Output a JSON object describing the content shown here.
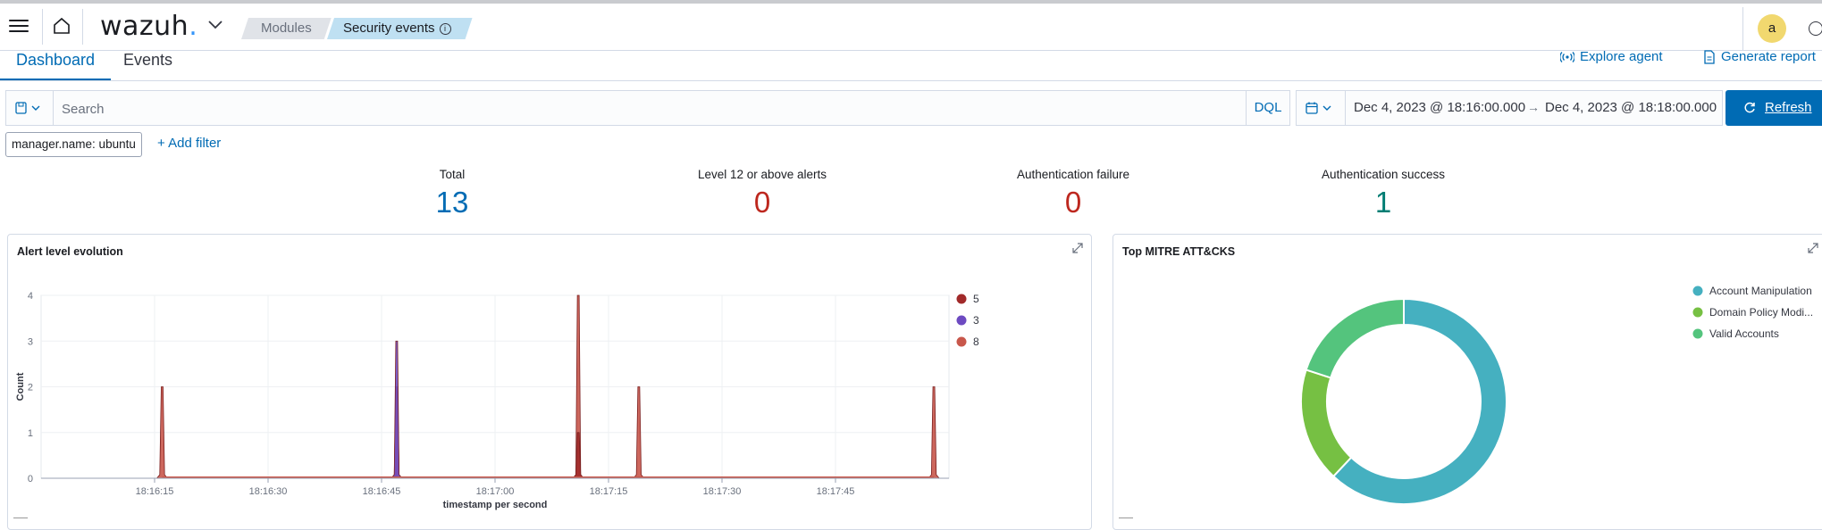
{
  "app": {
    "logo_text": "wazuh",
    "logo_dot": ".",
    "breadcrumb": [
      "Modules",
      "Security events"
    ],
    "avatar_letter": "a"
  },
  "tabs": [
    {
      "label": "Dashboard",
      "active": true
    },
    {
      "label": "Events",
      "active": false
    }
  ],
  "actions": {
    "explore_agent": "Explore agent",
    "generate_report": "Generate report"
  },
  "search": {
    "placeholder": "Search",
    "value": "",
    "query_language": "DQL"
  },
  "date_range": {
    "start": "Dec 4, 2023 @ 18:16:00.000",
    "arrow": "→",
    "end": "Dec 4, 2023 @ 18:18:00.000"
  },
  "refresh_label": "Refresh",
  "filter": {
    "pill": "manager.name: ubuntu",
    "add_label": "+ Add filter"
  },
  "metrics": [
    {
      "label": "Total",
      "value": "13",
      "color": "#006bb4"
    },
    {
      "label": "Level 12 or above alerts",
      "value": "0",
      "color": "#bd271e"
    },
    {
      "label": "Authentication failure",
      "value": "0",
      "color": "#bd271e"
    },
    {
      "label": "Authentication success",
      "value": "1",
      "color": "#017d73"
    }
  ],
  "panels": {
    "alert_title": "Alert level evolution",
    "mitre_title": "Top MITRE ATT&CKS"
  },
  "chart_data": [
    {
      "type": "area",
      "title": "Alert level evolution",
      "xlabel": "timestamp per second",
      "ylabel": "Count",
      "x_ticks": [
        "18:16:15",
        "18:16:30",
        "18:16:45",
        "18:17:00",
        "18:17:15",
        "18:17:30",
        "18:17:45"
      ],
      "y_ticks": [
        "0",
        "1",
        "2",
        "3",
        "4"
      ],
      "ylim": [
        0,
        4
      ],
      "xlim": [
        "18:16:00",
        "18:18:00"
      ],
      "grid": true,
      "legend_position": "right",
      "series": [
        {
          "name": "5",
          "color": "#a12a2a",
          "points": [
            {
              "x": "18:17:11",
              "y": 1
            }
          ]
        },
        {
          "name": "3",
          "color": "#6d4ac1",
          "points": [
            {
              "x": "18:16:47",
              "y": 3
            }
          ]
        },
        {
          "name": "8",
          "color": "#c8574b",
          "points": [
            {
              "x": "18:16:16",
              "y": 2
            },
            {
              "x": "18:16:47",
              "y": 2
            },
            {
              "x": "18:17:11",
              "y": 4
            },
            {
              "x": "18:17:19",
              "y": 2
            },
            {
              "x": "18:17:58",
              "y": 2
            }
          ]
        }
      ]
    },
    {
      "type": "pie",
      "title": "Top MITRE ATT&CKS",
      "donut": true,
      "legend_position": "right",
      "labels": [
        "Account Manipulation",
        "Domain Policy Modi...",
        "Valid Accounts"
      ],
      "values": [
        62,
        18,
        20
      ],
      "colors": [
        "#45b0c0",
        "#76c043",
        "#54c47d"
      ]
    }
  ]
}
